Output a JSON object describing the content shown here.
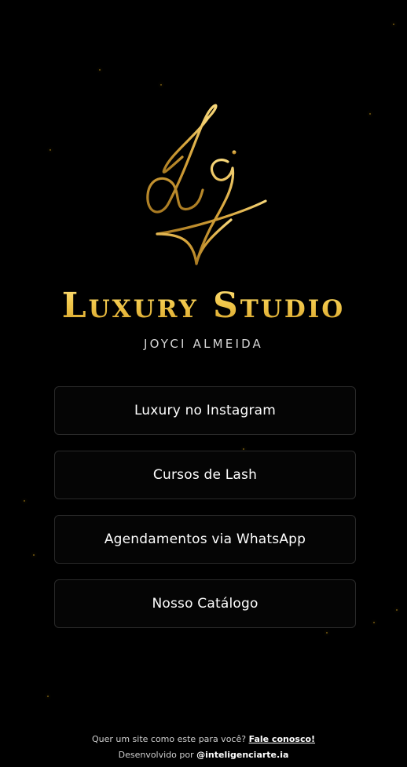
{
  "brand": {
    "logo_name": "lj-monogram-signature-logo",
    "title": "Luxury Studio",
    "subtitle": "JOYCI ALMEIDA"
  },
  "buttons": [
    {
      "label": "Luxury no Instagram"
    },
    {
      "label": "Cursos de Lash"
    },
    {
      "label": "Agendamentos via WhatsApp"
    },
    {
      "label": "Nosso Catálogo"
    }
  ],
  "footer": {
    "prompt_text": "Quer um site como este para você?",
    "contact_link": "Fale conosco!",
    "dev_text": "Desenvolvido por",
    "dev_link": "@inteligenciarte.ia"
  },
  "colors": {
    "background": "#000000",
    "gold": "#f1c74a",
    "button_border": "#2a2a2a"
  }
}
